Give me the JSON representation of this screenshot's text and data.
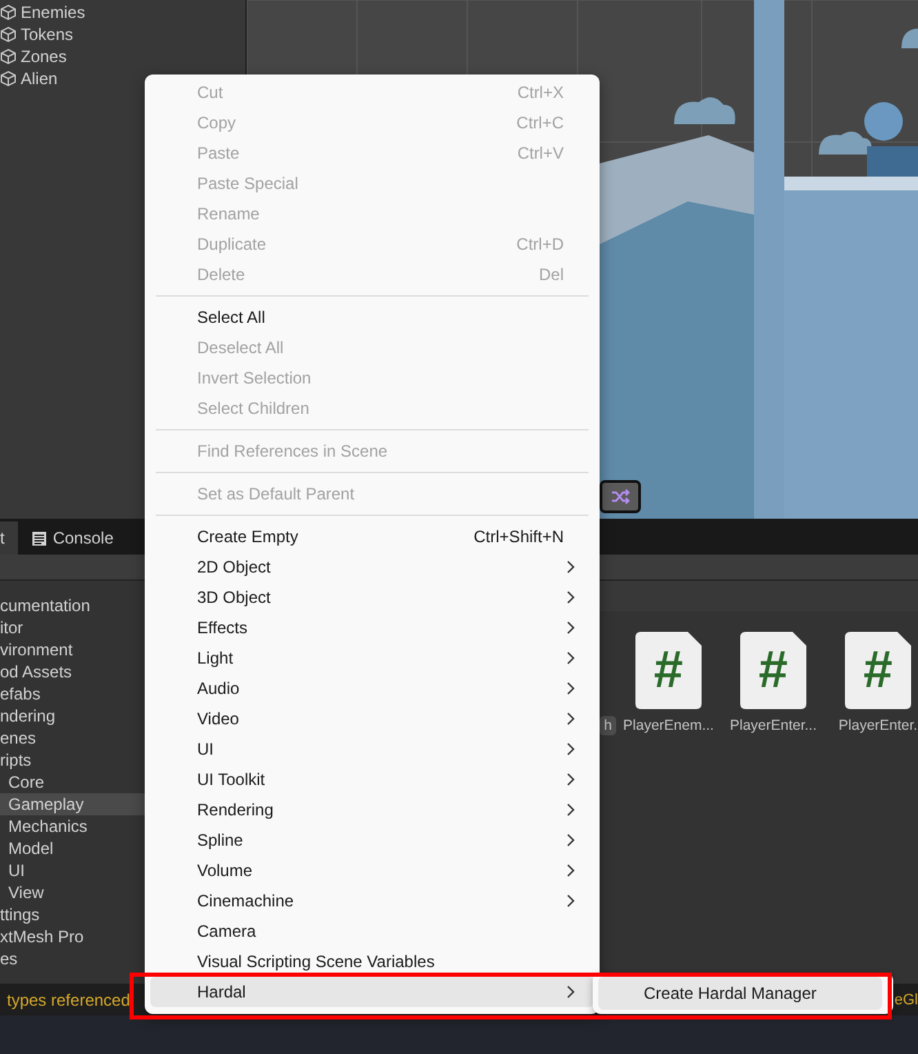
{
  "hierarchy": {
    "items": [
      {
        "label": "Enemies"
      },
      {
        "label": "Tokens"
      },
      {
        "label": "Zones"
      },
      {
        "label": "Alien"
      }
    ]
  },
  "project": {
    "tabs": [
      {
        "label": "t",
        "selected": true,
        "kind": "plain"
      },
      {
        "label": "Console",
        "selected": false,
        "kind": "console"
      }
    ],
    "folders": [
      {
        "label": "cumentation",
        "selected": false
      },
      {
        "label": "itor",
        "selected": false
      },
      {
        "label": "vironment",
        "selected": false
      },
      {
        "label": "od Assets",
        "selected": false
      },
      {
        "label": "efabs",
        "selected": false
      },
      {
        "label": "ndering",
        "selected": false
      },
      {
        "label": "enes",
        "selected": false
      },
      {
        "label": "ripts",
        "selected": false,
        "children": [
          {
            "label": "Core",
            "selected": false
          },
          {
            "label": "Gameplay",
            "selected": true
          },
          {
            "label": "Mechanics",
            "selected": false
          },
          {
            "label": "Model",
            "selected": false
          },
          {
            "label": "UI",
            "selected": false
          },
          {
            "label": "View",
            "selected": false
          }
        ]
      },
      {
        "label": "ttings",
        "selected": false
      },
      {
        "label": "xtMesh Pro",
        "selected": false
      },
      {
        "label": "es",
        "selected": false
      }
    ],
    "assets": [
      {
        "label": "h",
        "selected": true,
        "kind": "label_only"
      },
      {
        "label": "PlayerEnem...",
        "selected": false,
        "kind": "script",
        "icon": "#"
      },
      {
        "label": "PlayerEnter...",
        "selected": false,
        "kind": "script",
        "icon": "#"
      },
      {
        "label": "PlayerEnter.",
        "selected": false,
        "kind": "script",
        "icon": "#"
      }
    ]
  },
  "status_bar": {
    "messages": [
      "types referenced",
      "eGl"
    ]
  },
  "context_menu": {
    "items": [
      {
        "kind": "item",
        "label": "Cut",
        "shortcut": "Ctrl+X",
        "disabled": true,
        "submenu": false,
        "highlighted": false
      },
      {
        "kind": "item",
        "label": "Copy",
        "shortcut": "Ctrl+C",
        "disabled": true,
        "submenu": false,
        "highlighted": false
      },
      {
        "kind": "item",
        "label": "Paste",
        "shortcut": "Ctrl+V",
        "disabled": true,
        "submenu": false,
        "highlighted": false
      },
      {
        "kind": "item",
        "label": "Paste Special",
        "disabled": true,
        "submenu": false,
        "highlighted": false
      },
      {
        "kind": "item",
        "label": "Rename",
        "disabled": true,
        "submenu": false,
        "highlighted": false
      },
      {
        "kind": "item",
        "label": "Duplicate",
        "shortcut": "Ctrl+D",
        "disabled": true,
        "submenu": false,
        "highlighted": false
      },
      {
        "kind": "item",
        "label": "Delete",
        "shortcut": "Del",
        "disabled": true,
        "submenu": false,
        "highlighted": false
      },
      {
        "kind": "separator"
      },
      {
        "kind": "item",
        "label": "Select All",
        "disabled": false,
        "submenu": false,
        "highlighted": false
      },
      {
        "kind": "item",
        "label": "Deselect All",
        "disabled": true,
        "submenu": false,
        "highlighted": false
      },
      {
        "kind": "item",
        "label": "Invert Selection",
        "disabled": true,
        "submenu": false,
        "highlighted": false
      },
      {
        "kind": "item",
        "label": "Select Children",
        "disabled": true,
        "submenu": false,
        "highlighted": false
      },
      {
        "kind": "separator"
      },
      {
        "kind": "item",
        "label": "Find References in Scene",
        "disabled": true,
        "submenu": false,
        "highlighted": false
      },
      {
        "kind": "separator"
      },
      {
        "kind": "item",
        "label": "Set as Default Parent",
        "disabled": true,
        "submenu": false,
        "highlighted": false
      },
      {
        "kind": "separator"
      },
      {
        "kind": "item",
        "label": "Create Empty",
        "shortcut": "Ctrl+Shift+N",
        "disabled": false,
        "submenu": false,
        "highlighted": false
      },
      {
        "kind": "item",
        "label": "2D Object",
        "disabled": false,
        "submenu": true,
        "highlighted": false
      },
      {
        "kind": "item",
        "label": "3D Object",
        "disabled": false,
        "submenu": true,
        "highlighted": false
      },
      {
        "kind": "item",
        "label": "Effects",
        "disabled": false,
        "submenu": true,
        "highlighted": false
      },
      {
        "kind": "item",
        "label": "Light",
        "disabled": false,
        "submenu": true,
        "highlighted": false
      },
      {
        "kind": "item",
        "label": "Audio",
        "disabled": false,
        "submenu": true,
        "highlighted": false
      },
      {
        "kind": "item",
        "label": "Video",
        "disabled": false,
        "submenu": true,
        "highlighted": false
      },
      {
        "kind": "item",
        "label": "UI",
        "disabled": false,
        "submenu": true,
        "highlighted": false
      },
      {
        "kind": "item",
        "label": "UI Toolkit",
        "disabled": false,
        "submenu": true,
        "highlighted": false
      },
      {
        "kind": "item",
        "label": "Rendering",
        "disabled": false,
        "submenu": true,
        "highlighted": false
      },
      {
        "kind": "item",
        "label": "Spline",
        "disabled": false,
        "submenu": true,
        "highlighted": false
      },
      {
        "kind": "item",
        "label": "Volume",
        "disabled": false,
        "submenu": true,
        "highlighted": false
      },
      {
        "kind": "item",
        "label": "Cinemachine",
        "disabled": false,
        "submenu": true,
        "highlighted": false
      },
      {
        "kind": "item",
        "label": "Camera",
        "disabled": false,
        "submenu": false,
        "highlighted": false
      },
      {
        "kind": "item",
        "label": "Visual Scripting Scene Variables",
        "disabled": false,
        "submenu": false,
        "highlighted": false
      },
      {
        "kind": "item",
        "label": "Hardal",
        "disabled": false,
        "submenu": true,
        "highlighted": true
      }
    ],
    "submenu": {
      "items": [
        {
          "label": "Create Hardal Manager",
          "highlighted": true
        }
      ]
    }
  }
}
